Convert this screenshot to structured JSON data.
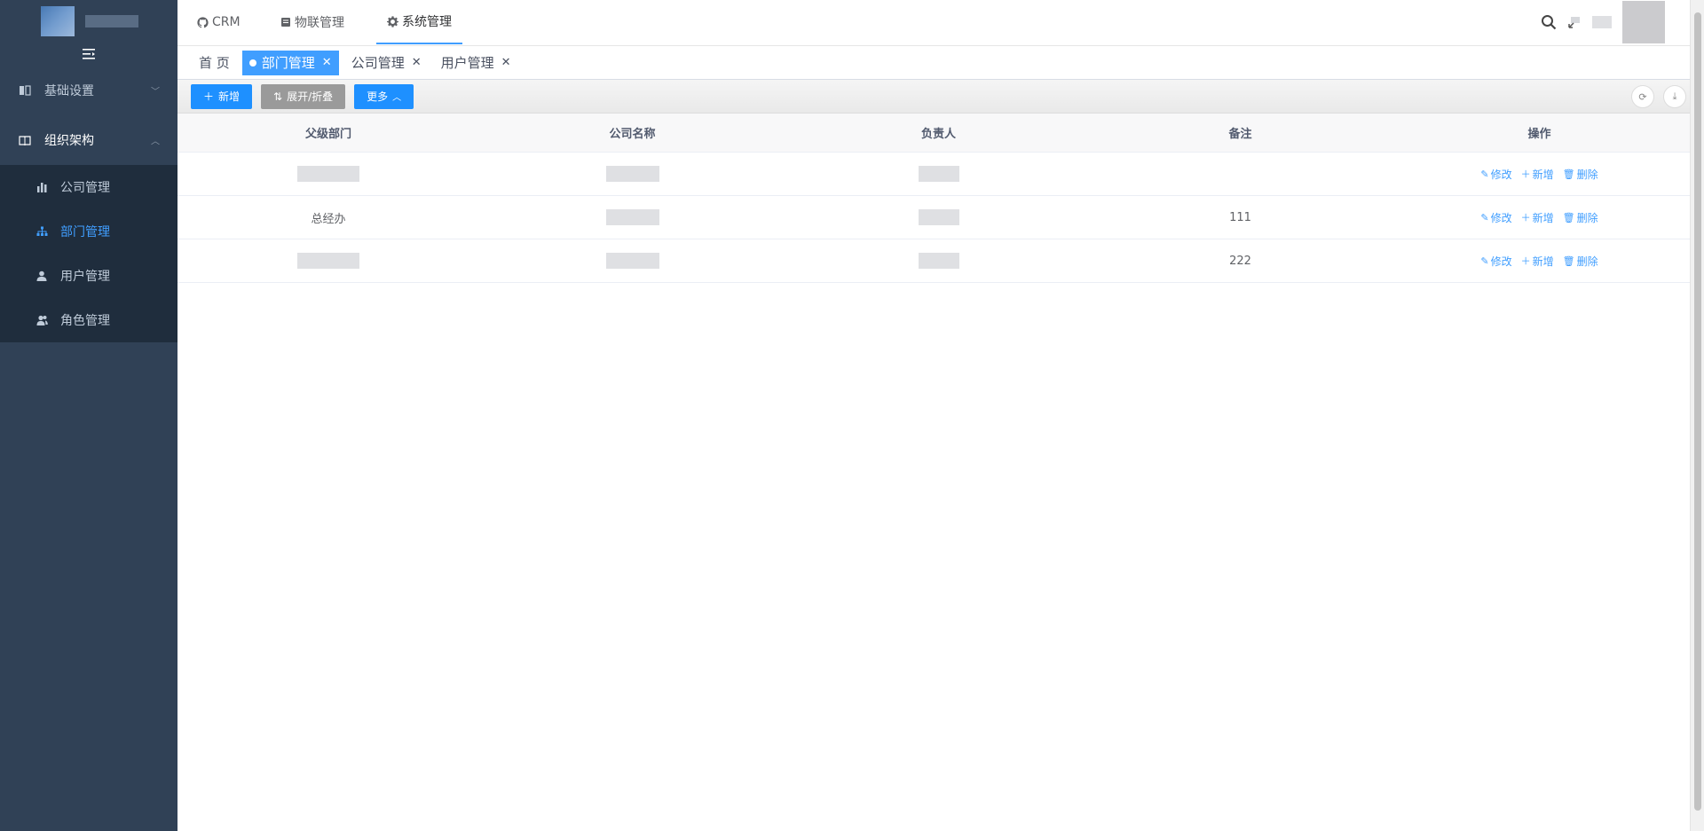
{
  "topnav": {
    "items": [
      {
        "label": "CRM",
        "icon": "github-icon"
      },
      {
        "label": "物联管理",
        "icon": "server-icon"
      },
      {
        "label": "系统管理",
        "icon": "gear-icon"
      }
    ]
  },
  "sidebar": {
    "groups": [
      {
        "label": "基础设置",
        "icon": "book-icon",
        "expanded": false
      },
      {
        "label": "组织架构",
        "icon": "book-open-icon",
        "expanded": true,
        "items": [
          {
            "label": "公司管理",
            "icon": "bar-chart-icon"
          },
          {
            "label": "部门管理",
            "icon": "sitemap-icon",
            "active": true
          },
          {
            "label": "用户管理",
            "icon": "user-icon"
          },
          {
            "label": "角色管理",
            "icon": "user-group-icon"
          }
        ]
      }
    ]
  },
  "tabs": [
    {
      "label": "首 页"
    },
    {
      "label": "部门管理",
      "active": true
    },
    {
      "label": "公司管理"
    },
    {
      "label": "用户管理"
    }
  ],
  "toolbar": {
    "add_label": "新增",
    "toggle_label": "展开/折叠",
    "more_label": "更多"
  },
  "table": {
    "headers": [
      "父级部门",
      "公司名称",
      "负责人",
      "备注",
      "操作"
    ],
    "rows": [
      {
        "parent": "",
        "company": "",
        "leader": "",
        "remark": ""
      },
      {
        "parent": "总经办",
        "company": "",
        "leader": "",
        "remark": "111"
      },
      {
        "parent": "",
        "company": "",
        "leader": "",
        "remark": "222"
      }
    ],
    "actions": {
      "edit": "修改",
      "add": "新增",
      "delete": "删除"
    }
  },
  "colors": {
    "primary": "#409eff",
    "sidebar_bg": "#304156"
  }
}
